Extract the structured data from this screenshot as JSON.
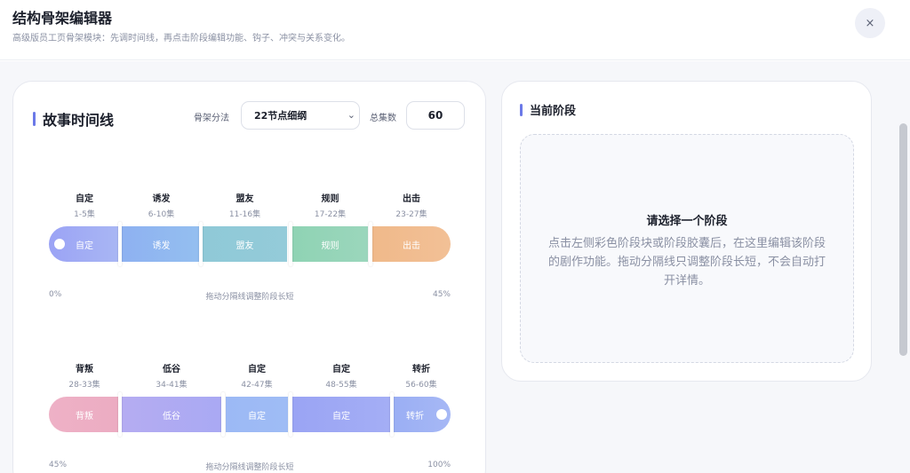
{
  "header": {
    "title": "结构骨架编辑器",
    "subtitle": "高级版员工页骨架模块：先调时间线，再点击阶段编辑功能、钩子、冲突与关系变化。",
    "close_label": "×"
  },
  "timeline": {
    "title": "故事时间线",
    "method_label": "骨架分法",
    "method_value": "22节点细纲",
    "method_chevron": "⌄",
    "episodes_label": "总集数",
    "episodes_value": "60",
    "rows": [
      {
        "segments": [
          {
            "name": "自定",
            "range": "1-5集",
            "label": "自定",
            "color_from": "#9ba3f5",
            "color_to": "#a9b7f4"
          },
          {
            "name": "诱发",
            "range": "6-10集",
            "label": "诱发",
            "color_from": "#8eb1f1",
            "color_to": "#94bff0"
          },
          {
            "name": "盟友",
            "range": "11-16集",
            "label": "盟友",
            "color_from": "#8fc9d7",
            "color_to": "#94cbd9"
          },
          {
            "name": "规则",
            "range": "17-22集",
            "label": "规则",
            "color_from": "#8fd3b4",
            "color_to": "#9bd6bc"
          },
          {
            "name": "出击",
            "range": "23-27集",
            "label": "出击",
            "color_from": "#f0b98a",
            "color_to": "#f2c096"
          }
        ],
        "axis_left": "0%",
        "axis_center": "拖动分隔线调整阶段长短",
        "axis_right": "45%"
      },
      {
        "segments": [
          {
            "name": "背叛",
            "range": "28-33集",
            "label": "背叛",
            "color_from": "#eeb1c6",
            "color_to": "#ecacc2"
          },
          {
            "name": "低谷",
            "range": "34-41集",
            "label": "低谷",
            "color_from": "#b5acf2",
            "color_to": "#a9a9f3"
          },
          {
            "name": "自定",
            "range": "42-47集",
            "label": "自定",
            "color_from": "#9cb9f5",
            "color_to": "#9fbcf5"
          },
          {
            "name": "自定",
            "range": "48-55集",
            "label": "自定",
            "color_from": "#9aa4f4",
            "color_to": "#a4aef5"
          },
          {
            "name": "转折",
            "range": "56-60集",
            "label": "转折",
            "color_from": "#9aaef4",
            "color_to": "#a6b8f5"
          }
        ],
        "axis_left": "45%",
        "axis_center": "拖动分隔线调整阶段长短",
        "axis_right": "100%"
      }
    ]
  },
  "stage": {
    "title": "当前阶段",
    "placeholder_title": "请选择一个阶段",
    "placeholder_desc": "点击左侧彩色阶段块或阶段胶囊后，在这里编辑该阶段的剧作功能。拖动分隔线只调整阶段长短，不会自动打开详情。"
  },
  "colors": {
    "accent": "#6b79e8"
  }
}
